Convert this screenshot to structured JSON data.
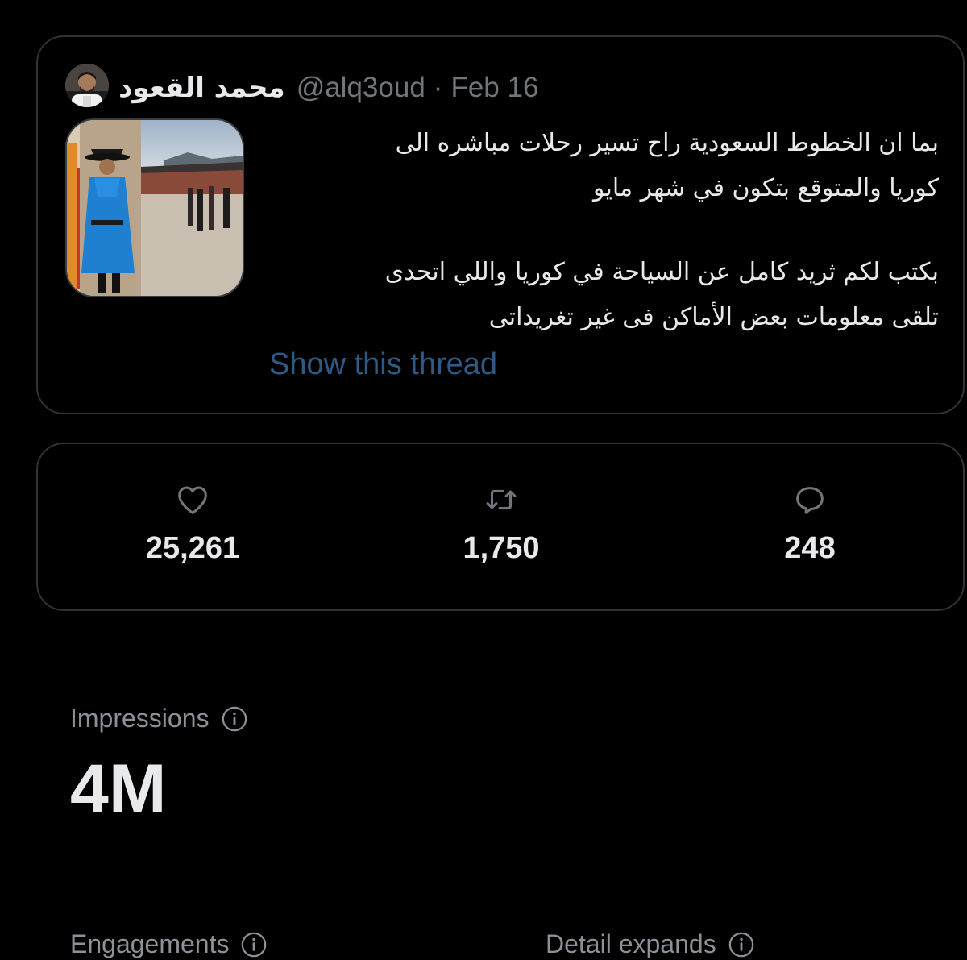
{
  "tweet": {
    "author_name": "محمد القعود",
    "handle": "@alq3oud",
    "separator": "·",
    "date": "Feb 16",
    "text_line_1": "بما ان الخطوط السعودية راح تسير رحلات مباشره الى",
    "text_line_2": "كوريا والمتوقع بتكون في شهر مايو",
    "text_line_3": "بكتب لكم ثريد كامل عن السياحة في كوريا واللي اتحدى",
    "text_line_4": "تلقى معلومات بعض الأماكن فى غير تغريداتى",
    "show_thread": "Show this thread"
  },
  "stats": {
    "likes": "25,261",
    "retweets": "1,750",
    "replies": "248"
  },
  "metrics": {
    "impressions_label": "Impressions",
    "impressions_value": "4M",
    "engagements_label": "Engagements",
    "detail_expands_label": "Detail expands"
  },
  "colors": {
    "background": "#000000",
    "border": "#2f3336",
    "text_primary": "#e7e9ea",
    "text_secondary": "#71767b",
    "link": "#2e5a85"
  },
  "icons": {
    "like": "heart-icon",
    "retweet": "retweet-icon",
    "reply": "reply-icon",
    "info": "info-icon"
  }
}
